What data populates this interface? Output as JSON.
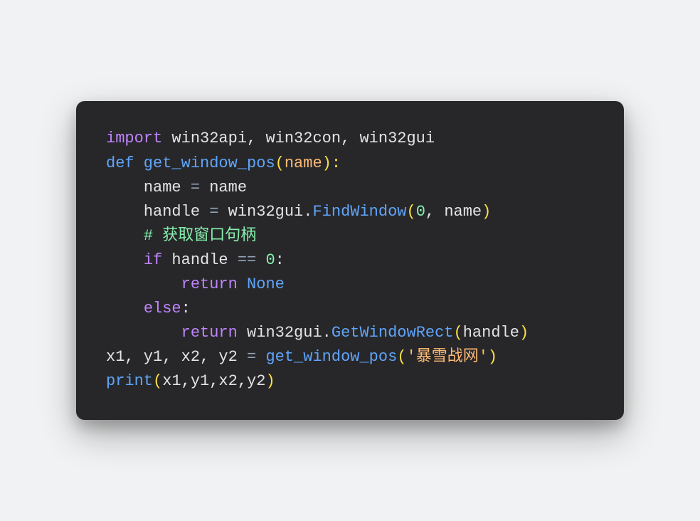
{
  "code": {
    "line1": {
      "import": "import",
      "modules": " win32api, win32con, win32gui"
    },
    "line2": {
      "def": "def",
      "fn": " get_window_pos",
      "lparen": "(",
      "param": "name",
      "rparen_colon": "):"
    },
    "line3": {
      "indent": "    ",
      "lhs": "name ",
      "eq": "=",
      "rhs": " name"
    },
    "line4": {
      "indent": "    ",
      "lhs": "handle ",
      "eq": "=",
      "mod": " win32gui",
      "dot": ".",
      "method": "FindWindow",
      "lparen": "(",
      "arg1": "0",
      "comma": ", ",
      "arg2": "name",
      "rparen": ")"
    },
    "line5": {
      "indent": "    ",
      "comment": "# 获取窗口句柄"
    },
    "line6": {
      "indent": "    ",
      "if": "if",
      "cond": " handle ",
      "op": "==",
      "sp": " ",
      "zero": "0",
      "colon": ":"
    },
    "line7": {
      "indent": "        ",
      "return": "return",
      "sp": " ",
      "none": "None"
    },
    "line8": {
      "indent": "    ",
      "else": "else",
      "colon": ":"
    },
    "line9": {
      "indent": "        ",
      "return": "return",
      "mod": " win32gui",
      "dot": ".",
      "method": "GetWindowRect",
      "lparen": "(",
      "arg": "handle",
      "rparen": ")"
    },
    "line10": {
      "lhs": "x1, y1, x2, y2 ",
      "eq": "=",
      "fn": " get_window_pos",
      "lparen": "(",
      "str": "'暴雪战网'",
      "rparen": ")"
    },
    "line11": {
      "fn": "print",
      "lparen": "(",
      "args": "x1,y1,x2,y2",
      "rparen": ")"
    }
  }
}
